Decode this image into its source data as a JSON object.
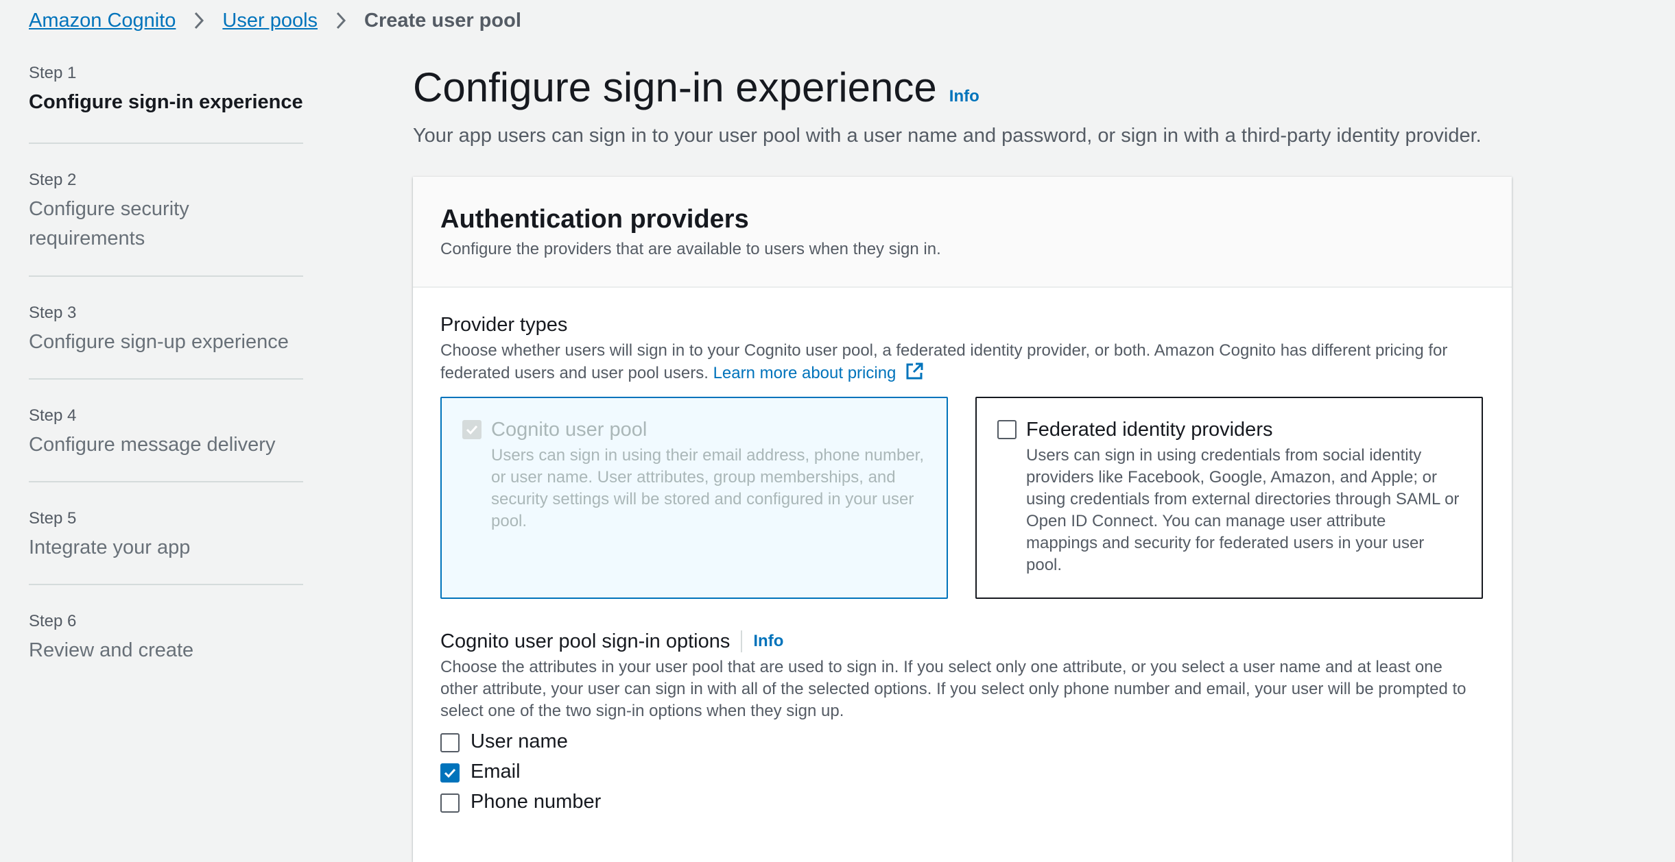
{
  "breadcrumb": {
    "items": [
      "Amazon Cognito",
      "User pools"
    ],
    "current": "Create user pool"
  },
  "steps": [
    {
      "num": "Step 1",
      "title": "Configure sign-in experience",
      "active": true
    },
    {
      "num": "Step 2",
      "title": "Configure security requirements"
    },
    {
      "num": "Step 3",
      "title": "Configure sign-up experience"
    },
    {
      "num": "Step 4",
      "title": "Configure message delivery"
    },
    {
      "num": "Step 5",
      "title": "Integrate your app"
    },
    {
      "num": "Step 6",
      "title": "Review and create"
    }
  ],
  "page": {
    "title": "Configure sign-in experience",
    "info": "Info",
    "description": "Your app users can sign in to your user pool with a user name and password, or sign in with a third-party identity provider."
  },
  "panel": {
    "title": "Authentication providers",
    "description": "Configure the providers that are available to users when they sign in.",
    "provider_types": {
      "label": "Provider types",
      "description": "Choose whether users will sign in to your Cognito user pool, a federated identity provider, or both. Amazon Cognito has different pricing for federated users and user pool users.",
      "link": "Learn more about pricing",
      "tiles": [
        {
          "title": "Cognito user pool",
          "description": "Users can sign in using their email address, phone number, or user name. User attributes, group memberships, and security settings will be stored and configured in your user pool.",
          "checked": true,
          "disabled": true
        },
        {
          "title": "Federated identity providers",
          "description": "Users can sign in using credentials from social identity providers like Facebook, Google, Amazon, and Apple; or using credentials from external directories through SAML or Open ID Connect. You can manage user attribute mappings and security for federated users in your user pool.",
          "checked": false
        }
      ]
    },
    "sign_in_options": {
      "label": "Cognito user pool sign-in options",
      "info": "Info",
      "description": "Choose the attributes in your user pool that are used to sign in. If you select only one attribute, or you select a user name and at least one other attribute, your user can sign in with all of the selected options. If you select only phone number and email, your user will be prompted to select one of the two sign-in options when they sign up.",
      "options": [
        {
          "label": "User name",
          "checked": false
        },
        {
          "label": "Email",
          "checked": true
        },
        {
          "label": "Phone number",
          "checked": false
        }
      ]
    }
  },
  "colors": {
    "link": "#0073bb",
    "background": "#f2f3f3",
    "selected_tile_bg": "#f1faff"
  }
}
